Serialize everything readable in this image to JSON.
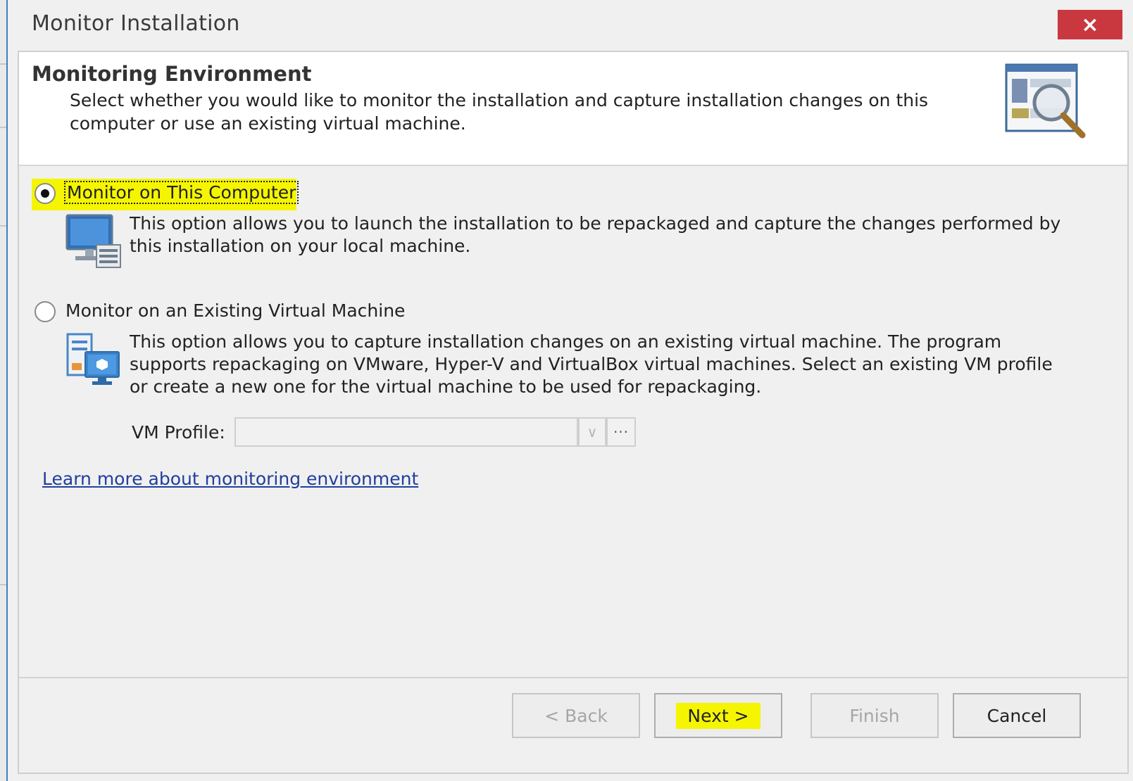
{
  "window": {
    "title": "Monitor Installation",
    "close_icon": "×"
  },
  "header": {
    "title": "Monitoring Environment",
    "description": "Select whether you would like to monitor the installation and capture installation changes on this computer or use an existing virtual machine.",
    "icon": "magnifier-window-icon"
  },
  "options": [
    {
      "label": "Monitor on This Computer",
      "description": "This option allows you to launch the installation to be repackaged and capture the changes performed by this installation on your local machine.",
      "selected": true,
      "icon": "local-computer-icon"
    },
    {
      "label": "Monitor on an Existing Virtual Machine",
      "description": "This option allows you to capture installation changes on an existing virtual machine. The program supports repackaging on VMware, Hyper-V and VirtualBox virtual machines. Select an existing VM profile or create a new one for the virtual machine to be used for repackaging.",
      "selected": false,
      "icon": "virtual-machine-icon"
    }
  ],
  "vm_profile": {
    "label": "VM Profile:",
    "value": "",
    "browse_label": "···",
    "dropdown_glyph": "∨"
  },
  "learn_more": "Learn more about monitoring environment",
  "buttons": {
    "back": "< Back",
    "next": "Next >",
    "finish": "Finish",
    "cancel": "Cancel"
  },
  "colors": {
    "close_button": "#c9383f",
    "highlight": "#f5f500",
    "link": "#1f3f9e"
  }
}
